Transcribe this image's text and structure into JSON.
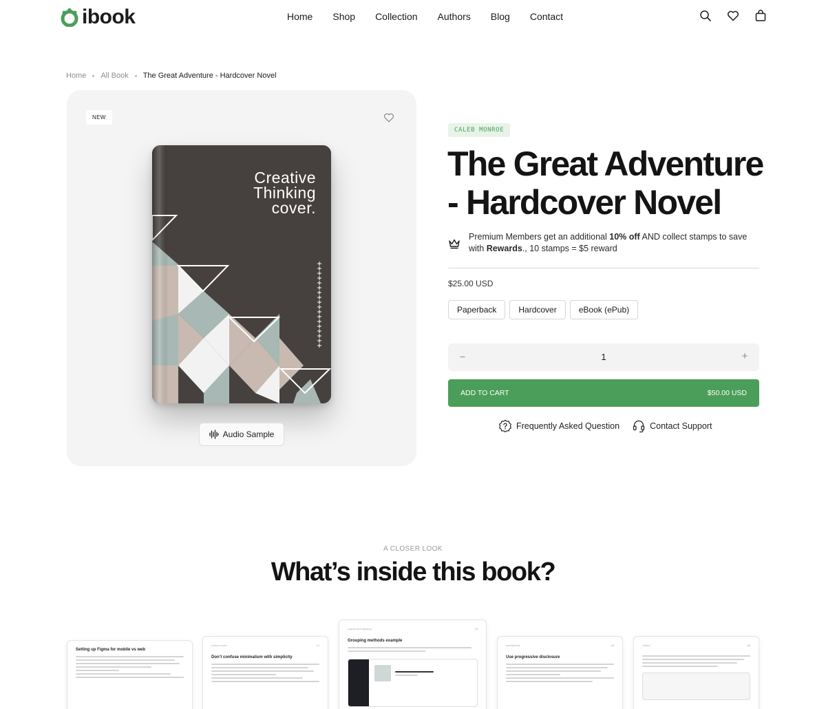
{
  "brand": {
    "name": "ibook",
    "accent": "#4b9e5a"
  },
  "nav": [
    "Home",
    "Shop",
    "Collection",
    "Authors",
    "Blog",
    "Contact"
  ],
  "header_icons": [
    "search-icon",
    "heart-icon",
    "bag-icon"
  ],
  "breadcrumb": {
    "home": "Home",
    "section": "All Book",
    "current": "The Great Adventure - Hardcover Novel"
  },
  "product": {
    "badge": "NEW",
    "cover_text": "Creative\nThinking\ncover.",
    "audio_label": "Audio Sample",
    "author": "CALEB MONROE",
    "title": "The Great Adventure - Hardcover Novel",
    "promo": {
      "pre": "Premium Members get an additional ",
      "discount": "10% off",
      "mid": " AND collect stamps to save with ",
      "rewards": "Rewards",
      "post": "., 10 stamps = $5 reward"
    },
    "price": "$25.00 USD",
    "formats": [
      "Paperback",
      "Hardcover",
      "eBook (ePub)"
    ],
    "quantity": "1",
    "add_to_cart": "ADD TO CART",
    "total": "$50.00 USD",
    "faq": "Frequently Asked Question",
    "support": "Contact Support"
  },
  "closer_look": {
    "eyebrow": "A CLOSER LOOK",
    "heading": "What’s inside this book?",
    "pages": [
      {
        "heading": "Setting up Figma for mobile vs web"
      },
      {
        "heading": "Don’t confuse minimalism with simplicity"
      },
      {
        "heading": "Grouping methods example"
      },
      {
        "heading": "Use progressive disclosure"
      },
      {
        "heading": ""
      }
    ]
  }
}
